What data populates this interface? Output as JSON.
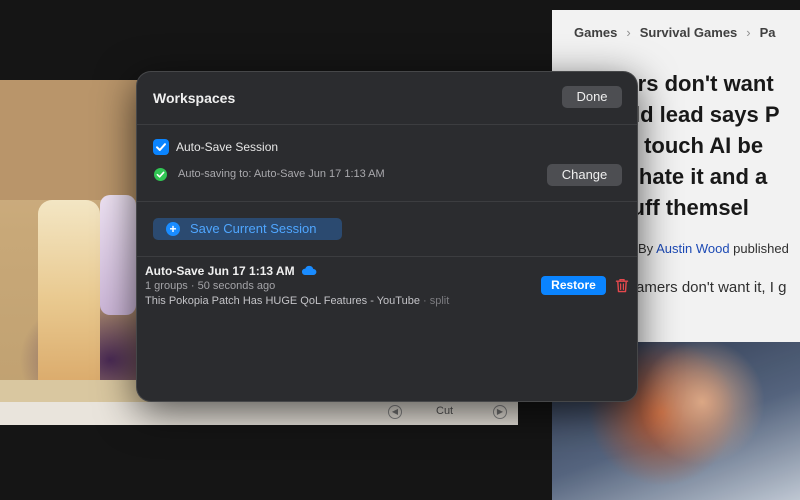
{
  "background": {
    "video": {
      "controls_label": "Cut",
      "prev_icon": "chevron-left-circle-icon",
      "next_icon": "chevron-right-circle-icon"
    },
    "article": {
      "breadcrumb": [
        "Games",
        "Survival Games",
        "Pa"
      ],
      "headline_lines": [
        "ners don't want",
        "orld lead says P",
        "n't touch AI be",
        "rs hate it and a",
        "stuff themsel"
      ],
      "byline_prefix": "By",
      "byline_author": "Austin Wood",
      "byline_suffix": "published",
      "dek": "amers don't want it, I g"
    }
  },
  "panel": {
    "title": "Workspaces",
    "done_label": "Done",
    "auto_save": {
      "checked": true,
      "label": "Auto-Save Session",
      "status": "Auto-saving to: Auto-Save Jun 17 1:13 AM",
      "change_label": "Change"
    },
    "save_current_label": "Save Current Session",
    "sessions": [
      {
        "name": "Auto-Save Jun 17 1:13 AM",
        "meta": "1 groups · 50 seconds ago",
        "tab_title": "This Pokopia Patch Has HUGE QoL Features - YouTube",
        "tab_suffix": "· split",
        "restore_label": "Restore",
        "cloud_icon": "cloud-icon",
        "delete_icon": "trash-icon"
      }
    ]
  },
  "colors": {
    "accent": "#0a84ff",
    "status_green": "#31c654",
    "danger": "#e5484d",
    "panel_bg": "#2b2c2f"
  }
}
